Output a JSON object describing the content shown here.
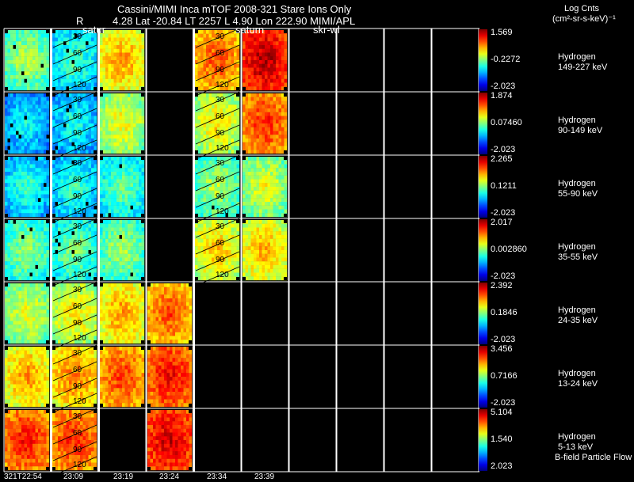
{
  "header": {
    "title": "Cassini/MIMI Inca mTOF  2008-321   Stare   Ions Only",
    "geometry": "4.28 Lat -20.84 LT 2257 L       4.90 Lon       222.90  MIMI/APL",
    "r_label": "R",
    "saturn_label_1": "satur",
    "saturn_label_2": "saturn",
    "skrwl_label": "skr-wl",
    "units_title": "Log Cnts",
    "units_label": "(cm²-sr-s-keV)⁻¹"
  },
  "footer": {
    "bfield_label": "B-field Particle Flow"
  },
  "chart_data": {
    "type": "heatmap",
    "species": "Hydrogen",
    "time_labels": [
      "321T22:54",
      "23:09",
      "23:19",
      "23:24",
      "23:34",
      "23:39"
    ],
    "contour_labels": [
      "30",
      "60",
      "90",
      "120"
    ],
    "rows": [
      {
        "name": "Hydrogen",
        "energy": "149-227 keV",
        "cb_max": "1.569",
        "cb_mid": "-0.2272",
        "cb_min": "-2.023",
        "present": [
          1,
          1,
          1,
          0,
          1,
          1
        ],
        "levels": [
          0.45,
          0.35,
          0.62,
          null,
          0.7,
          0.85
        ]
      },
      {
        "name": "Hydrogen",
        "energy": "90-149 keV",
        "cb_max": "1.874",
        "cb_mid": "0.07460",
        "cb_min": "-2.023",
        "present": [
          1,
          1,
          1,
          0,
          1,
          1
        ],
        "levels": [
          0.28,
          0.3,
          0.52,
          null,
          0.55,
          0.74
        ]
      },
      {
        "name": "Hydrogen",
        "energy": "55-90 keV",
        "cb_max": "2.265",
        "cb_mid": "0.1211",
        "cb_min": "-2.023",
        "present": [
          1,
          1,
          1,
          0,
          1,
          1
        ],
        "levels": [
          0.32,
          0.33,
          0.38,
          null,
          0.45,
          0.5
        ]
      },
      {
        "name": "Hydrogen",
        "energy": "35-55 keV",
        "cb_max": "2.017",
        "cb_mid": "0.002860",
        "cb_min": "-2.023",
        "present": [
          1,
          1,
          1,
          0,
          1,
          1
        ],
        "levels": [
          0.42,
          0.4,
          0.44,
          null,
          0.58,
          0.6
        ]
      },
      {
        "name": "Hydrogen",
        "energy": "24-35 keV",
        "cb_max": "2.392",
        "cb_mid": "0.1846",
        "cb_min": "-2.023",
        "present": [
          1,
          1,
          1,
          1,
          0,
          0
        ],
        "levels": [
          0.5,
          0.55,
          0.62,
          0.7,
          null,
          null
        ]
      },
      {
        "name": "Hydrogen",
        "energy": "13-24 keV",
        "cb_max": "3.456",
        "cb_mid": "0.7166",
        "cb_min": "-2.023",
        "present": [
          1,
          1,
          1,
          1,
          0,
          0
        ],
        "levels": [
          0.62,
          0.65,
          0.72,
          0.78,
          null,
          null
        ]
      },
      {
        "name": "Hydrogen",
        "energy": "5-13 keV",
        "cb_max": "5.104",
        "cb_mid": "1.540",
        "cb_min": "2.023",
        "present": [
          1,
          1,
          0,
          1,
          0,
          0
        ],
        "levels": [
          0.76,
          0.74,
          null,
          0.82,
          null,
          null
        ]
      }
    ]
  }
}
